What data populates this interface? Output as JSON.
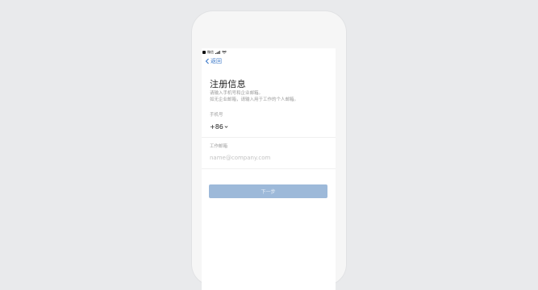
{
  "status_bar": {
    "carrier": "微信"
  },
  "nav": {
    "back_label": "返回"
  },
  "page": {
    "title": "注册信息",
    "subtitle_line1": "请输入手机号和企业邮箱。",
    "subtitle_line2": "如无企业邮箱，请输入用于工作的个人邮箱。"
  },
  "phone_field": {
    "label": "手机号",
    "country_code": "+86",
    "value": ""
  },
  "email_field": {
    "label": "工作邮箱",
    "placeholder": "name@company.com",
    "value": ""
  },
  "actions": {
    "next_label": "下一步"
  },
  "colors": {
    "accent": "#3b78c9",
    "button_disabled": "#9db9d9",
    "background": "#e9eaec"
  }
}
